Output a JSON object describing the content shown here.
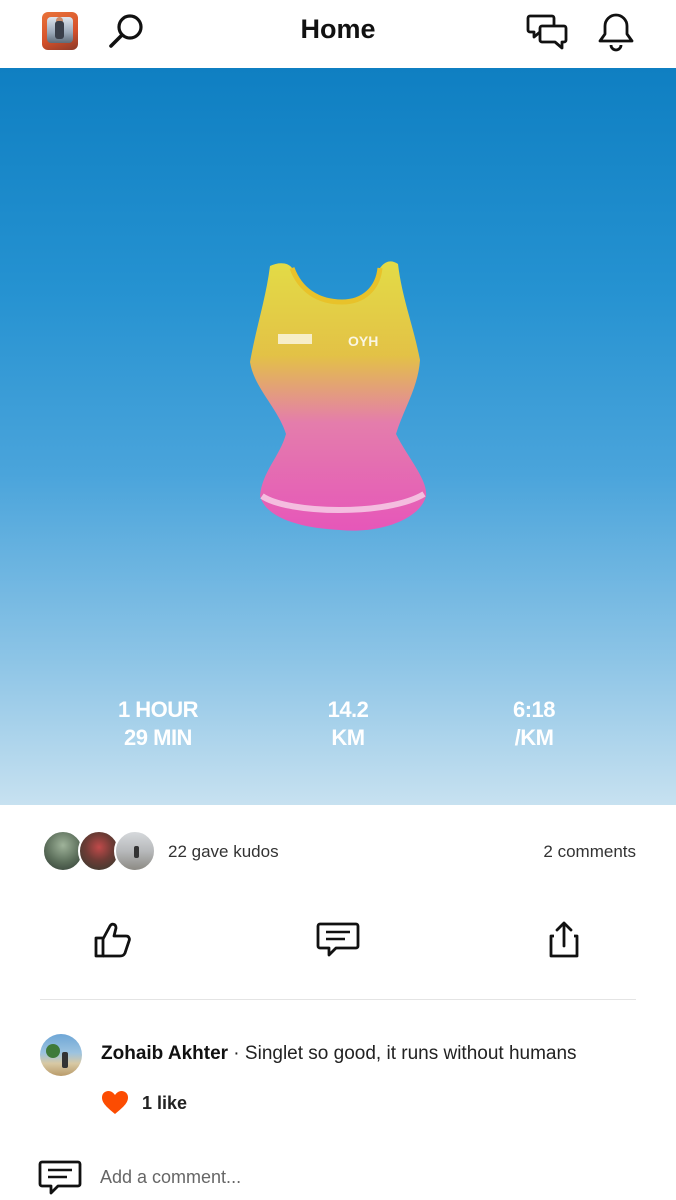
{
  "header": {
    "title": "Home",
    "icons": [
      "profile-avatar",
      "search-icon",
      "messages-icon",
      "notifications-bell-icon"
    ]
  },
  "activity": {
    "stats": [
      {
        "line1": "1 HOUR",
        "line2": "29 MIN"
      },
      {
        "line1": "14.2",
        "line2": "KM"
      },
      {
        "line1": "6:18",
        "line2": "/KM"
      }
    ]
  },
  "kudos": {
    "text": "22 gave kudos",
    "comments": "2 comments"
  },
  "actions": {
    "icons": [
      "thumbs-up-icon",
      "comment-icon",
      "share-icon"
    ]
  },
  "comment": {
    "author": "Zohaib Akhter",
    "separator": " · ",
    "text": "Singlet so good, it runs without humans",
    "likes": "1 like"
  },
  "add_comment": {
    "placeholder": "Add a comment..."
  },
  "colors": {
    "accent_orange": "#fc4c02",
    "text_dark": "#111111",
    "sky_top": "#0f7fc2",
    "sky_bottom": "#c7e1f0"
  }
}
